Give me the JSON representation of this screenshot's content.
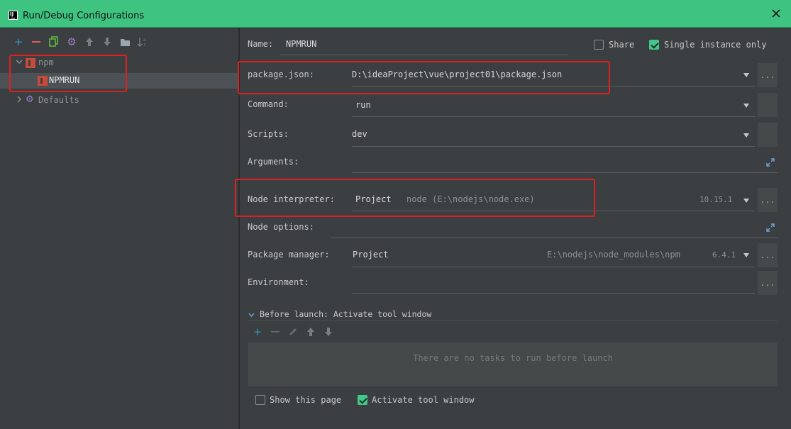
{
  "window": {
    "title": "Run/Debug Configurations",
    "icon": "intellij-app-icon"
  },
  "colors": {
    "titlebar": "#3fc380",
    "accent_green": "#43c68a",
    "highlight_red": "#e02020",
    "npm_red": "#c64b3b"
  },
  "left_toolbar": {
    "icons": [
      "add-icon",
      "remove-icon",
      "copy-icon",
      "settings-icon",
      "move-up-icon",
      "move-down-icon",
      "folder-icon",
      "sort-alpha-icon"
    ]
  },
  "tree": {
    "npm_group": "npm",
    "npm_item": "NPMRUN",
    "defaults": "Defaults"
  },
  "form": {
    "name_label": "Name:",
    "name_value": "NPMRUN",
    "share_label": "Share",
    "single_instance_label": "Single instance only",
    "package_json_label": "package.json:",
    "package_json_value": "D:\\ideaProject\\vue\\project01\\package.json",
    "command_label": "Command:",
    "command_value": "run",
    "scripts_label": "Scripts:",
    "scripts_value": "dev",
    "arguments_label": "Arguments:",
    "node_interpreter_label": "Node interpreter:",
    "node_interpreter_value": "Project",
    "node_interpreter_path": "node (E:\\nodejs\\node.exe)",
    "node_version": "10.15.1",
    "node_options_label": "Node options:",
    "package_manager_label": "Package manager:",
    "package_manager_value": "Project",
    "package_manager_path": "E:\\nodejs\\node_modules\\npm",
    "package_manager_version": "6.4.1",
    "environment_label": "Environment:",
    "browse_label": "...",
    "before_launch_label": "Before launch: Activate tool window",
    "no_tasks_text": "There are no tasks to run before launch",
    "show_page_label": "Show this page",
    "activate_window_label": "Activate tool window"
  },
  "state": {
    "share_checked": false,
    "single_instance_checked": true,
    "show_page_checked": false,
    "activate_window_checked": true
  }
}
